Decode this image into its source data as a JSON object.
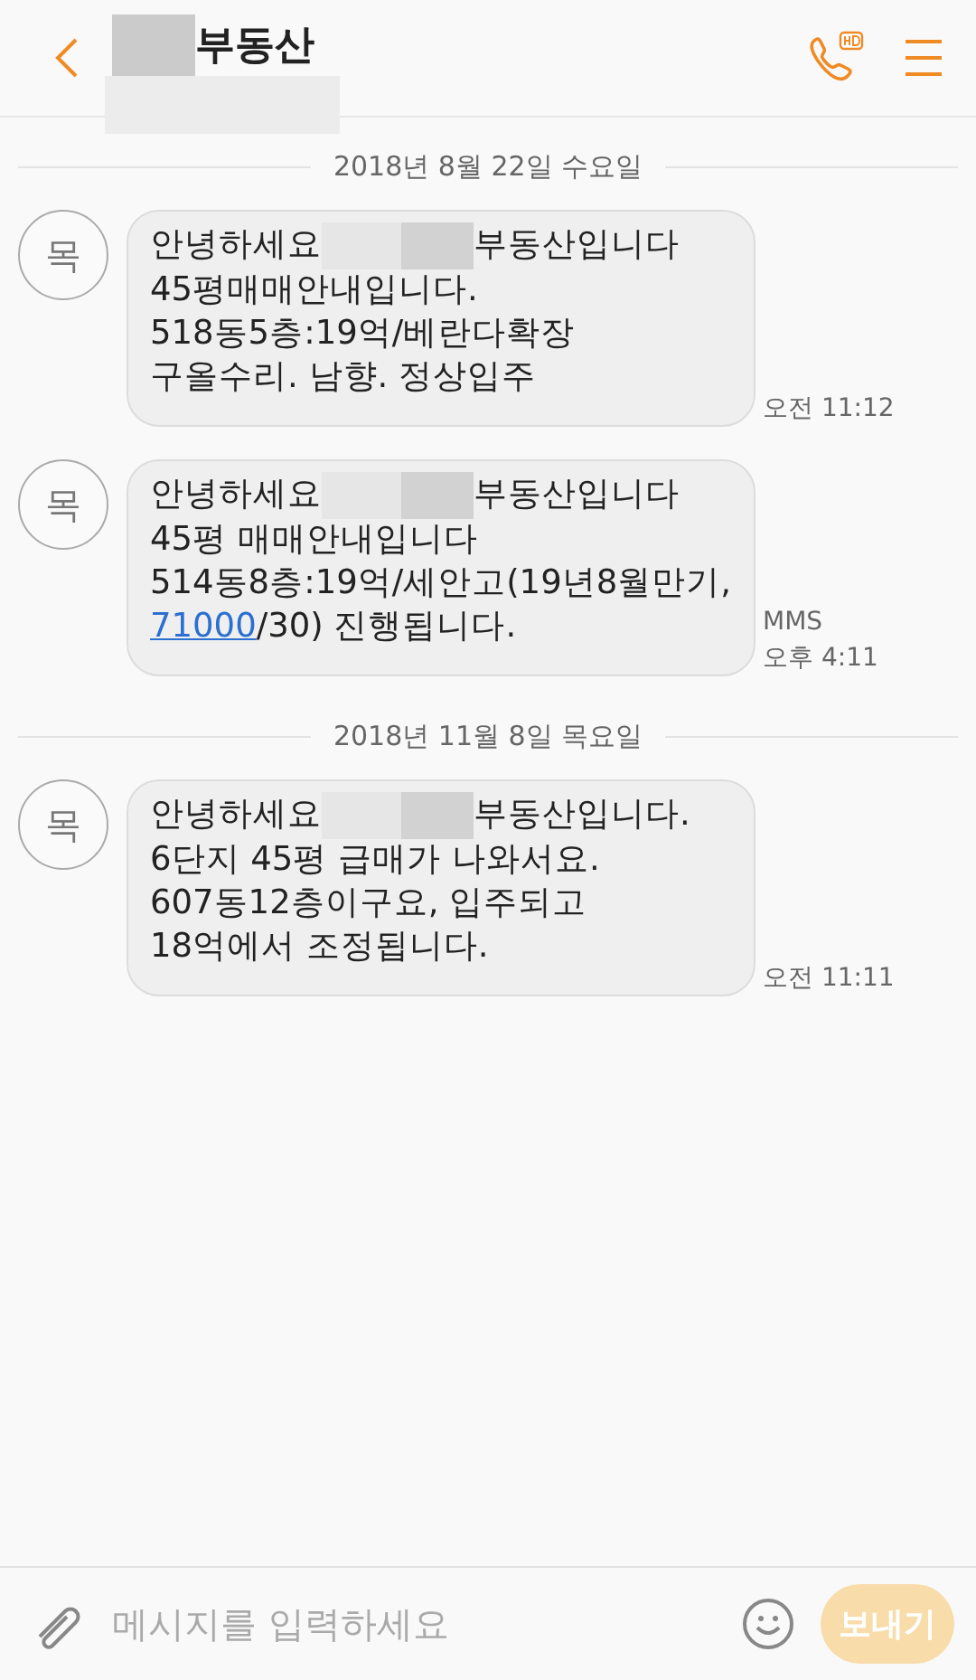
{
  "header": {
    "title": "부동산"
  },
  "groups": [
    {
      "date": "2018년 8월 22일 수요일",
      "messages": [
        {
          "avatar": "목",
          "lines": [
            [
              {
                "kind": "text",
                "text": "안녕하세요"
              },
              {
                "kind": "redacted"
              },
              {
                "kind": "text",
                "text": "부동산입니다"
              }
            ],
            [
              {
                "kind": "text",
                "text": "45평매매안내입니다."
              }
            ],
            [
              {
                "kind": "text",
                "text": "518동5층:19억/베란다확장"
              }
            ],
            [
              {
                "kind": "text",
                "text": "구올수리. 남향. 정상입주"
              }
            ]
          ],
          "time": "오전 11:12"
        },
        {
          "avatar": "목",
          "lines": [
            [
              {
                "kind": "text",
                "text": "안녕하세요"
              },
              {
                "kind": "redacted"
              },
              {
                "kind": "text",
                "text": "부동산입니다"
              }
            ],
            [
              {
                "kind": "text",
                "text": "45평 매매안내입니다"
              }
            ],
            [
              {
                "kind": "text",
                "text": "514동8층:19억/세안고(19년8월만기,"
              }
            ],
            [
              {
                "kind": "link",
                "text": "71000"
              },
              {
                "kind": "text",
                "text": "/30) 진행됩니다."
              }
            ]
          ],
          "type": "MMS",
          "time": "오후 4:11"
        }
      ]
    },
    {
      "date": "2018년 11월 8일 목요일",
      "messages": [
        {
          "avatar": "목",
          "lines": [
            [
              {
                "kind": "text",
                "text": "안녕하세요"
              },
              {
                "kind": "redacted"
              },
              {
                "kind": "text",
                "text": "부동산입니다."
              }
            ],
            [
              {
                "kind": "text",
                "text": "6단지 45평 급매가 나와서요."
              }
            ],
            [
              {
                "kind": "text",
                "text": "607동12층이구요, 입주되고"
              }
            ],
            [
              {
                "kind": "text",
                "text": "18억에서 조정됩니다."
              }
            ]
          ],
          "time": "오전 11:11"
        }
      ]
    }
  ],
  "composer": {
    "placeholder": "메시지를 입력하세요",
    "send": "보내기",
    "send_disabled": true
  }
}
